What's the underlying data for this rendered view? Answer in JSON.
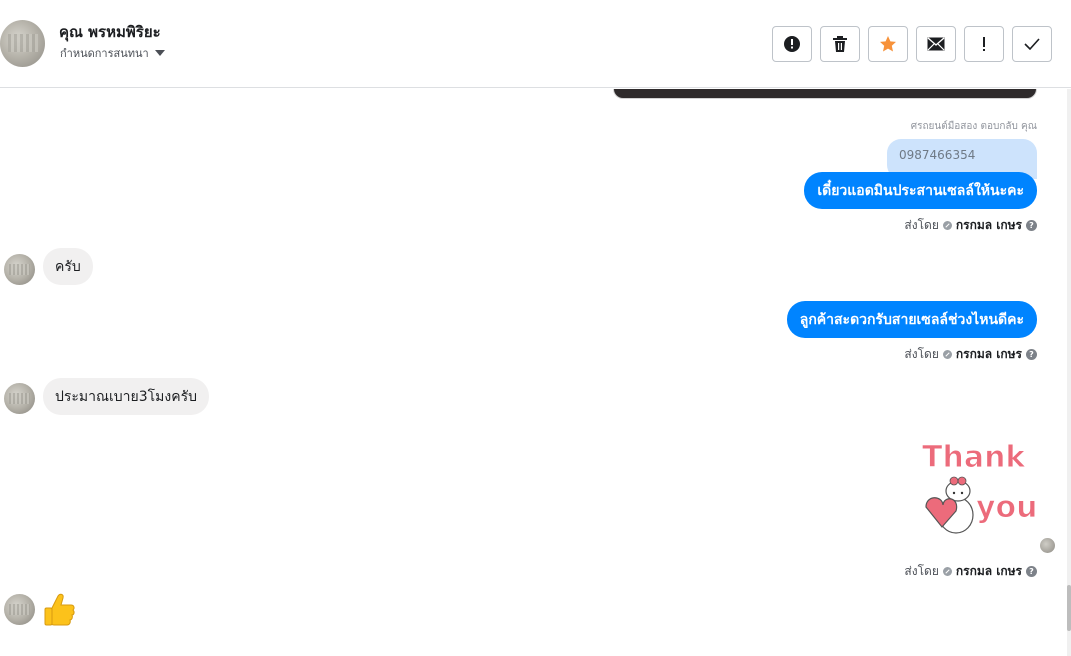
{
  "header": {
    "contact_name": "คุณ พรหมพิริยะ",
    "sub_label": "กำหนดการสนทนา",
    "toolbar": [
      {
        "icon": "alert-circle-icon"
      },
      {
        "icon": "trash-icon"
      },
      {
        "icon": "star-icon",
        "color": "#f7923a"
      },
      {
        "icon": "envelope-icon"
      },
      {
        "icon": "exclamation-icon"
      },
      {
        "icon": "checkmark-icon"
      }
    ]
  },
  "conversation": {
    "reply_caption": "ศรถยนต์มือสอง ตอบกลับ คุณ",
    "quoted_text": "0987466354",
    "messages": [
      {
        "direction": "out",
        "text": "เดี๋ยวแอดมินประสานเซลล์ให้นะคะ",
        "sent_label": "ส่งโดย",
        "agent": "กรกมล เกษร"
      },
      {
        "direction": "in",
        "text": "ครับ"
      },
      {
        "direction": "out",
        "text": "ลูกค้าสะดวกรับสายเซลล์ช่วงไหนดีคะ",
        "sent_label": "ส่งโดย",
        "agent": "กรกมล เกษร"
      },
      {
        "direction": "in",
        "text": "ประมาณเบาย3โมงครับ"
      },
      {
        "direction": "out",
        "sticker": "thank-you-sticker",
        "sticker_text": [
          "Thank",
          "you"
        ],
        "sent_label": "ส่งโดย",
        "agent": "กรกมล เกษร"
      },
      {
        "direction": "in",
        "emoji": "thumbs-up-icon"
      }
    ]
  },
  "colors": {
    "outgoing_bubble": "#0084ff",
    "incoming_bubble": "#f1f0f0",
    "quoted_bubble": "#cde3fc",
    "sticker_text": "#ec6b7b"
  }
}
